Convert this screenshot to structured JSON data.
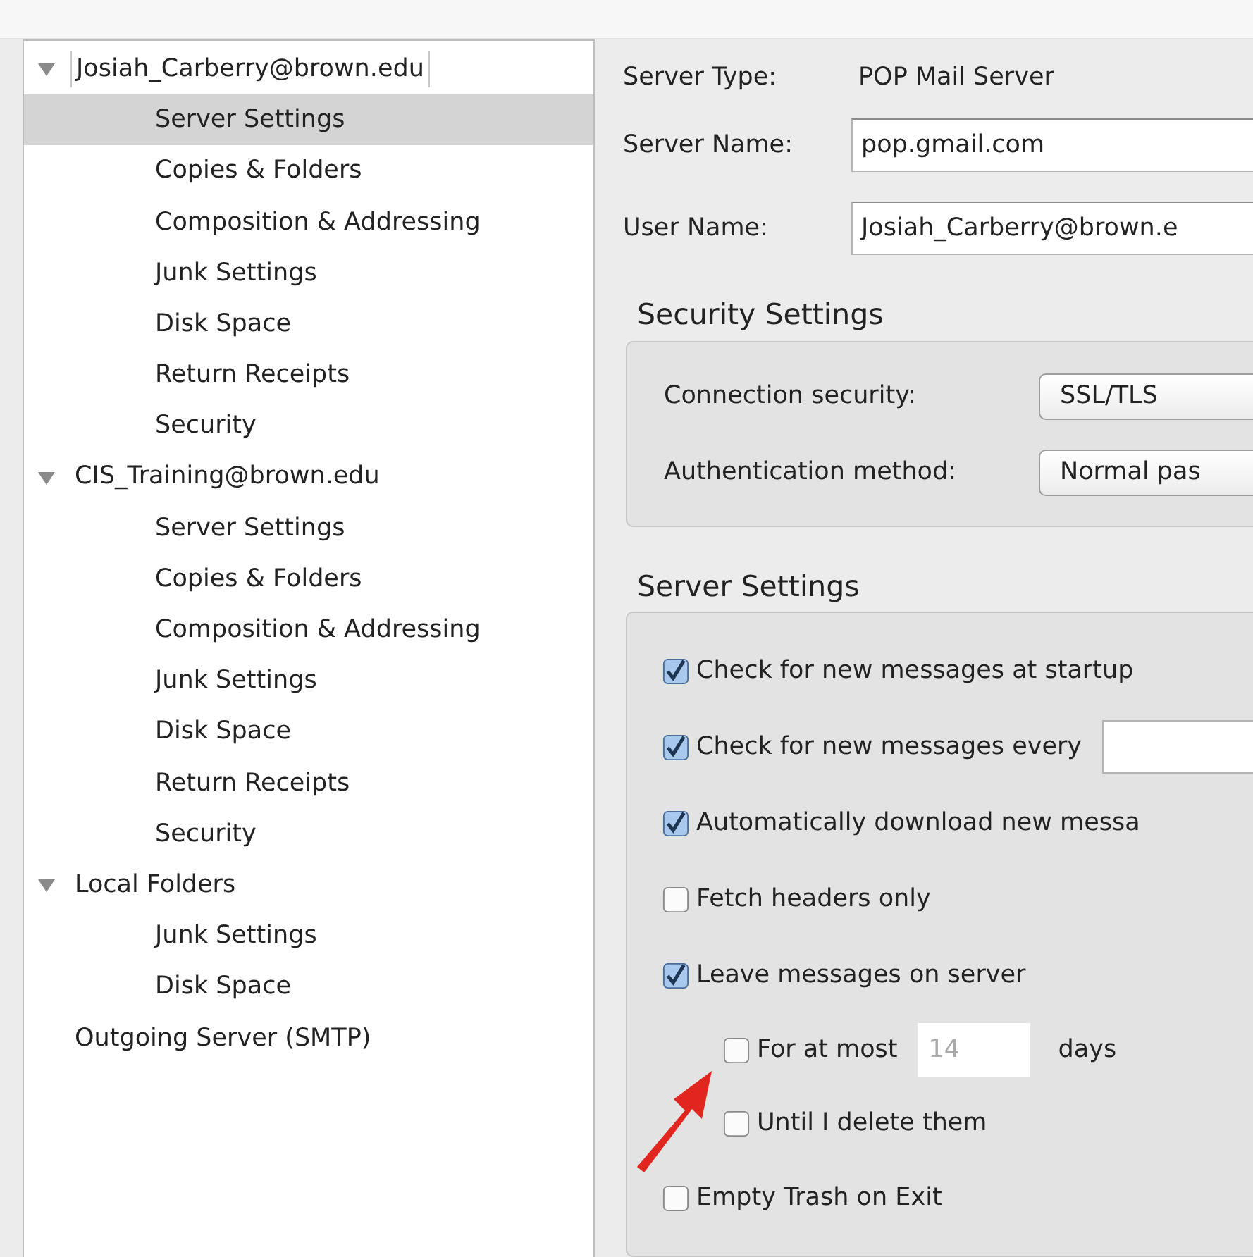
{
  "account_tree": [
    {
      "label": "Josiah_Carberry@brown.edu",
      "expanded": true,
      "selected": false,
      "focused": true,
      "children": [
        {
          "label": "Server Settings",
          "selected": true
        },
        {
          "label": "Copies & Folders",
          "selected": false
        },
        {
          "label": "Composition & Addressing",
          "selected": false
        },
        {
          "label": "Junk Settings",
          "selected": false
        },
        {
          "label": "Disk Space",
          "selected": false
        },
        {
          "label": "Return Receipts",
          "selected": false
        },
        {
          "label": "Security",
          "selected": false
        }
      ]
    },
    {
      "label": "CIS_Training@brown.edu",
      "expanded": true,
      "selected": false,
      "focused": false,
      "children": [
        {
          "label": "Server Settings",
          "selected": false
        },
        {
          "label": "Copies & Folders",
          "selected": false
        },
        {
          "label": "Composition & Addressing",
          "selected": false
        },
        {
          "label": "Junk Settings",
          "selected": false
        },
        {
          "label": "Disk Space",
          "selected": false
        },
        {
          "label": "Return Receipts",
          "selected": false
        },
        {
          "label": "Security",
          "selected": false
        }
      ]
    },
    {
      "label": "Local Folders",
      "expanded": true,
      "selected": false,
      "focused": false,
      "children": [
        {
          "label": "Junk Settings",
          "selected": false
        },
        {
          "label": "Disk Space",
          "selected": false
        }
      ]
    },
    {
      "label": "Outgoing Server (SMTP)",
      "selected": false,
      "focused": false
    }
  ],
  "server": {
    "type_label": "Server Type:",
    "type_value": "POP Mail Server",
    "name_label": "Server Name:",
    "name_value": "pop.gmail.com",
    "user_label": "User Name:",
    "user_value": "Josiah_Carberry@brown.e"
  },
  "security_settings": {
    "title": "Security Settings",
    "rows": [
      {
        "label": "Connection security:",
        "value": "SSL/TLS"
      },
      {
        "label": "Authentication method:",
        "value": "Normal pas"
      }
    ]
  },
  "server_settings": {
    "title": "Server Settings",
    "options": [
      {
        "kind": "plain",
        "label": "Check for new messages at startup",
        "checked": true
      },
      {
        "kind": "field",
        "label": "Check for new messages every",
        "checked": true
      },
      {
        "kind": "plain",
        "label": "Automatically download new messa",
        "checked": true
      },
      {
        "kind": "plain",
        "label": "Fetch headers only",
        "checked": false
      },
      {
        "kind": "plain",
        "label": "Leave messages on server",
        "checked": true,
        "children": [
          {
            "kind": "field",
            "label": "For at most",
            "checked": false,
            "value": "14",
            "disabled": true,
            "suffix": "days"
          },
          {
            "kind": "plain",
            "label": "Until I delete them",
            "checked": false
          }
        ]
      },
      {
        "kind": "plain",
        "label": "Empty Trash on Exit",
        "checked": false
      }
    ]
  }
}
